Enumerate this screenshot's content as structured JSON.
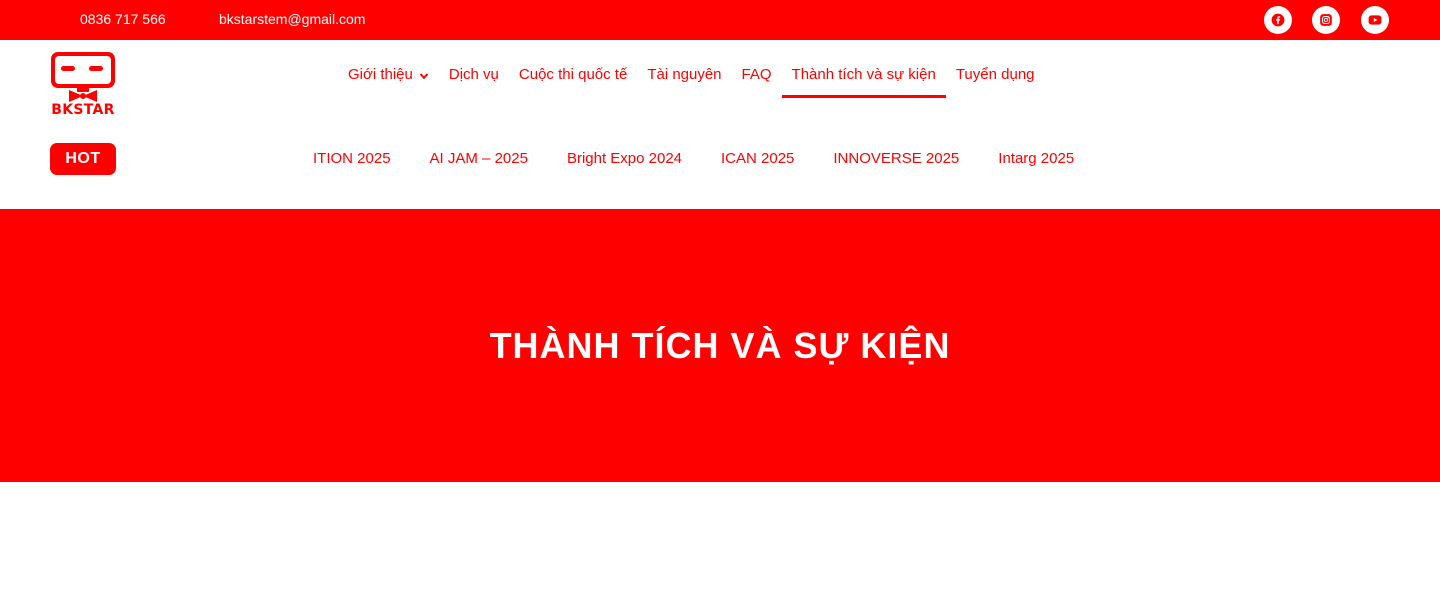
{
  "topbar": {
    "phone": "0836 717 566",
    "email": "bkstarstem@gmail.com",
    "social": [
      {
        "icon": "facebook-icon"
      },
      {
        "icon": "instagram-icon"
      },
      {
        "icon": "youtube-icon"
      }
    ]
  },
  "logo": {
    "text": "BKSTAR"
  },
  "nav": {
    "items": [
      {
        "label": "Giới thiệu",
        "has_dropdown": true
      },
      {
        "label": "Dịch vụ"
      },
      {
        "label": "Cuộc thi quốc tế"
      },
      {
        "label": "Tài nguyên"
      },
      {
        "label": "FAQ"
      },
      {
        "label": "Thành tích và sự kiện",
        "active": true
      },
      {
        "label": "Tuyển dụng"
      }
    ]
  },
  "hot": {
    "label": "HOT",
    "items": [
      "ITION 2025",
      "AI JAM – 2025",
      "Bright Expo 2024",
      "ICAN 2025",
      "INNOVERSE 2025",
      "Intarg 2025"
    ]
  },
  "hero": {
    "title": "THÀNH TÍCH VÀ SỰ KIỆN"
  },
  "colors": {
    "brand": "#ff0000",
    "background": "#ffffff",
    "text_on_brand": "#ffffff"
  }
}
